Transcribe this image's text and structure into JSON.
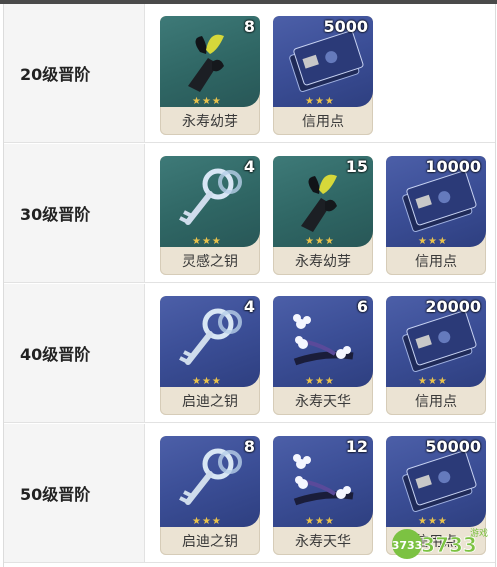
{
  "rows": [
    {
      "label": "20级晋阶",
      "items": [
        {
          "name": "永寿幼芽",
          "count": "8",
          "icon": "sprout-icon",
          "bg": "green"
        },
        {
          "name": "信用点",
          "count": "5000",
          "icon": "credit-card-icon",
          "bg": "blue"
        }
      ]
    },
    {
      "label": "30级晋阶",
      "items": [
        {
          "name": "灵感之钥",
          "count": "4",
          "icon": "key-icon",
          "bg": "green"
        },
        {
          "name": "永寿幼芽",
          "count": "15",
          "icon": "sprout-icon",
          "bg": "green"
        },
        {
          "name": "信用点",
          "count": "10000",
          "icon": "credit-card-icon",
          "bg": "blue"
        }
      ]
    },
    {
      "label": "40级晋阶",
      "items": [
        {
          "name": "启迪之钥",
          "count": "4",
          "icon": "key-icon",
          "bg": "blue"
        },
        {
          "name": "永寿天华",
          "count": "6",
          "icon": "flower-branch-icon",
          "bg": "blue"
        },
        {
          "name": "信用点",
          "count": "20000",
          "icon": "credit-card-icon",
          "bg": "blue"
        }
      ]
    },
    {
      "label": "50级晋阶",
      "items": [
        {
          "name": "启迪之钥",
          "count": "8",
          "icon": "key-icon",
          "bg": "blue"
        },
        {
          "name": "永寿天华",
          "count": "12",
          "icon": "flower-branch-icon",
          "bg": "blue"
        },
        {
          "name": "信用点",
          "count": "50000",
          "icon": "credit-card-icon",
          "bg": "blue"
        }
      ]
    }
  ],
  "watermark": {
    "text": "3733游戏",
    "accent": "#7cc242"
  },
  "star_color": "#e9c24c"
}
